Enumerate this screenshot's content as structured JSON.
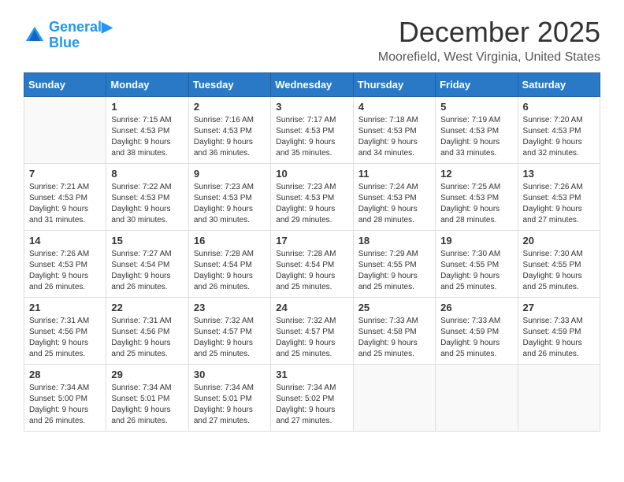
{
  "header": {
    "logo_line1": "General",
    "logo_line2": "Blue",
    "month_year": "December 2025",
    "location": "Moorefield, West Virginia, United States"
  },
  "days_of_week": [
    "Sunday",
    "Monday",
    "Tuesday",
    "Wednesday",
    "Thursday",
    "Friday",
    "Saturday"
  ],
  "weeks": [
    [
      {
        "day": "",
        "info": ""
      },
      {
        "day": "1",
        "info": "Sunrise: 7:15 AM\nSunset: 4:53 PM\nDaylight: 9 hours\nand 38 minutes."
      },
      {
        "day": "2",
        "info": "Sunrise: 7:16 AM\nSunset: 4:53 PM\nDaylight: 9 hours\nand 36 minutes."
      },
      {
        "day": "3",
        "info": "Sunrise: 7:17 AM\nSunset: 4:53 PM\nDaylight: 9 hours\nand 35 minutes."
      },
      {
        "day": "4",
        "info": "Sunrise: 7:18 AM\nSunset: 4:53 PM\nDaylight: 9 hours\nand 34 minutes."
      },
      {
        "day": "5",
        "info": "Sunrise: 7:19 AM\nSunset: 4:53 PM\nDaylight: 9 hours\nand 33 minutes."
      },
      {
        "day": "6",
        "info": "Sunrise: 7:20 AM\nSunset: 4:53 PM\nDaylight: 9 hours\nand 32 minutes."
      }
    ],
    [
      {
        "day": "7",
        "info": "Sunrise: 7:21 AM\nSunset: 4:53 PM\nDaylight: 9 hours\nand 31 minutes."
      },
      {
        "day": "8",
        "info": "Sunrise: 7:22 AM\nSunset: 4:53 PM\nDaylight: 9 hours\nand 30 minutes."
      },
      {
        "day": "9",
        "info": "Sunrise: 7:23 AM\nSunset: 4:53 PM\nDaylight: 9 hours\nand 30 minutes."
      },
      {
        "day": "10",
        "info": "Sunrise: 7:23 AM\nSunset: 4:53 PM\nDaylight: 9 hours\nand 29 minutes."
      },
      {
        "day": "11",
        "info": "Sunrise: 7:24 AM\nSunset: 4:53 PM\nDaylight: 9 hours\nand 28 minutes."
      },
      {
        "day": "12",
        "info": "Sunrise: 7:25 AM\nSunset: 4:53 PM\nDaylight: 9 hours\nand 28 minutes."
      },
      {
        "day": "13",
        "info": "Sunrise: 7:26 AM\nSunset: 4:53 PM\nDaylight: 9 hours\nand 27 minutes."
      }
    ],
    [
      {
        "day": "14",
        "info": "Sunrise: 7:26 AM\nSunset: 4:53 PM\nDaylight: 9 hours\nand 26 minutes."
      },
      {
        "day": "15",
        "info": "Sunrise: 7:27 AM\nSunset: 4:54 PM\nDaylight: 9 hours\nand 26 minutes."
      },
      {
        "day": "16",
        "info": "Sunrise: 7:28 AM\nSunset: 4:54 PM\nDaylight: 9 hours\nand 26 minutes."
      },
      {
        "day": "17",
        "info": "Sunrise: 7:28 AM\nSunset: 4:54 PM\nDaylight: 9 hours\nand 25 minutes."
      },
      {
        "day": "18",
        "info": "Sunrise: 7:29 AM\nSunset: 4:55 PM\nDaylight: 9 hours\nand 25 minutes."
      },
      {
        "day": "19",
        "info": "Sunrise: 7:30 AM\nSunset: 4:55 PM\nDaylight: 9 hours\nand 25 minutes."
      },
      {
        "day": "20",
        "info": "Sunrise: 7:30 AM\nSunset: 4:55 PM\nDaylight: 9 hours\nand 25 minutes."
      }
    ],
    [
      {
        "day": "21",
        "info": "Sunrise: 7:31 AM\nSunset: 4:56 PM\nDaylight: 9 hours\nand 25 minutes."
      },
      {
        "day": "22",
        "info": "Sunrise: 7:31 AM\nSunset: 4:56 PM\nDaylight: 9 hours\nand 25 minutes."
      },
      {
        "day": "23",
        "info": "Sunrise: 7:32 AM\nSunset: 4:57 PM\nDaylight: 9 hours\nand 25 minutes."
      },
      {
        "day": "24",
        "info": "Sunrise: 7:32 AM\nSunset: 4:57 PM\nDaylight: 9 hours\nand 25 minutes."
      },
      {
        "day": "25",
        "info": "Sunrise: 7:33 AM\nSunset: 4:58 PM\nDaylight: 9 hours\nand 25 minutes."
      },
      {
        "day": "26",
        "info": "Sunrise: 7:33 AM\nSunset: 4:59 PM\nDaylight: 9 hours\nand 25 minutes."
      },
      {
        "day": "27",
        "info": "Sunrise: 7:33 AM\nSunset: 4:59 PM\nDaylight: 9 hours\nand 26 minutes."
      }
    ],
    [
      {
        "day": "28",
        "info": "Sunrise: 7:34 AM\nSunset: 5:00 PM\nDaylight: 9 hours\nand 26 minutes."
      },
      {
        "day": "29",
        "info": "Sunrise: 7:34 AM\nSunset: 5:01 PM\nDaylight: 9 hours\nand 26 minutes."
      },
      {
        "day": "30",
        "info": "Sunrise: 7:34 AM\nSunset: 5:01 PM\nDaylight: 9 hours\nand 27 minutes."
      },
      {
        "day": "31",
        "info": "Sunrise: 7:34 AM\nSunset: 5:02 PM\nDaylight: 9 hours\nand 27 minutes."
      },
      {
        "day": "",
        "info": ""
      },
      {
        "day": "",
        "info": ""
      },
      {
        "day": "",
        "info": ""
      }
    ]
  ]
}
